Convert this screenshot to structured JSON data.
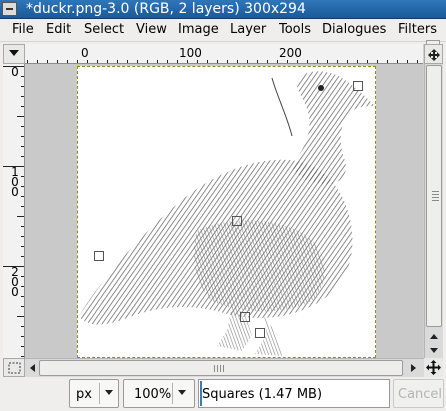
{
  "window": {
    "title": "*duckr.png-3.0 (RGB, 2 layers) 300x294",
    "accent_color": "#2f76b8"
  },
  "menubar": {
    "items": [
      {
        "label": "File",
        "mnemonic": "F"
      },
      {
        "label": "Edit",
        "mnemonic": "E"
      },
      {
        "label": "Select",
        "mnemonic": "S"
      },
      {
        "label": "View",
        "mnemonic": "V"
      },
      {
        "label": "Image",
        "mnemonic": "I"
      },
      {
        "label": "Layer",
        "mnemonic": "L"
      },
      {
        "label": "Tools",
        "mnemonic": "T"
      },
      {
        "label": "Dialogues",
        "mnemonic": "D"
      },
      {
        "label": "Filters",
        "mnemonic": "r"
      }
    ],
    "overflow_icon": "chevron-right-icon"
  },
  "rulers": {
    "horizontal_labels": [
      "0",
      "100",
      "200"
    ],
    "vertical_labels": [
      "0",
      "100",
      "200"
    ]
  },
  "canvas": {
    "image_name": "duckr.png",
    "selection_style": "dashed yellow border",
    "transform_handles": 7
  },
  "statusbar": {
    "unit": "px",
    "zoom": "100%",
    "message": "Squares (1.47 MB)",
    "cancel_label": "Cancel",
    "cancel_enabled": false
  },
  "icons": {
    "quick_mask": "pointer-triangle-icon",
    "navigate": "move-cross-icon",
    "zoom_toggle": "zoom-dotted-square-icon"
  }
}
